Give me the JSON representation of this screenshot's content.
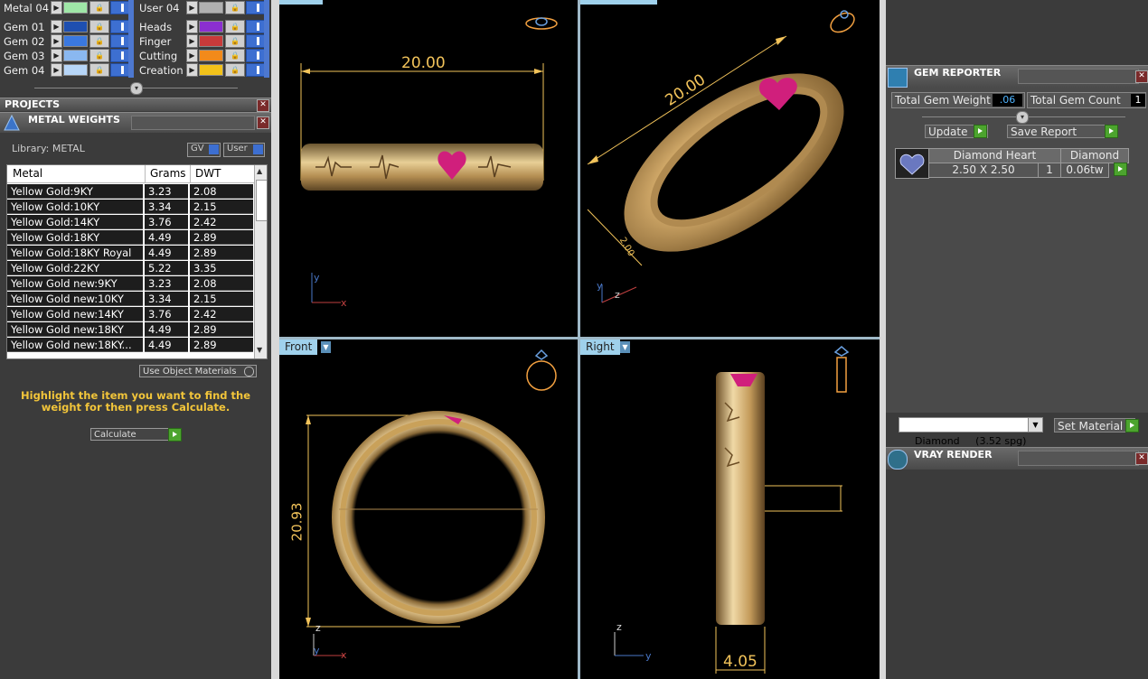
{
  "layers": {
    "left_column": [
      {
        "name": "Metal 04",
        "color": "#9fe6a7"
      },
      {
        "name": "Gem 01",
        "color": "#1e4fb0"
      },
      {
        "name": "Gem 02",
        "color": "#3a78e0"
      },
      {
        "name": "Gem 03",
        "color": "#8ab8f0"
      },
      {
        "name": "Gem 04",
        "color": "#b7d6f8"
      }
    ],
    "right_column": [
      {
        "name": "User 04",
        "color": "#b0b0b0"
      },
      {
        "name": "Heads",
        "color": "#8b2fd0"
      },
      {
        "name": "Finger",
        "color": "#c83a3a"
      },
      {
        "name": "Cutting",
        "color": "#f28a1a"
      },
      {
        "name": "Creation",
        "color": "#f2c21a"
      }
    ]
  },
  "projects": {
    "title": "PROJECTS"
  },
  "metal_weights": {
    "title": "METAL WEIGHTS",
    "library_label": "Library: METAL",
    "gv_label": "GV",
    "user_label": "User",
    "columns": [
      "Metal",
      "Grams",
      "DWT"
    ],
    "rows": [
      [
        "Yellow Gold:9KY",
        "3.23",
        "2.08"
      ],
      [
        "Yellow Gold:10KY",
        "3.34",
        "2.15"
      ],
      [
        "Yellow Gold:14KY",
        "3.76",
        "2.42"
      ],
      [
        "Yellow Gold:18KY",
        "4.49",
        "2.89"
      ],
      [
        "Yellow Gold:18KY Royal",
        "4.49",
        "2.89"
      ],
      [
        "Yellow Gold:22KY",
        "5.22",
        "3.35"
      ],
      [
        "Yellow Gold new:9KY",
        "3.23",
        "2.08"
      ],
      [
        "Yellow Gold new:10KY",
        "3.34",
        "2.15"
      ],
      [
        "Yellow Gold new:14KY",
        "3.76",
        "2.42"
      ],
      [
        "Yellow Gold new:18KY",
        "4.49",
        "2.89"
      ],
      [
        "Yellow Gold new:18KY...",
        "4.49",
        "2.89"
      ]
    ],
    "use_object_materials": "Use Object Materials",
    "instruction": "Highlight the item you want to find the weight for then press Calculate.",
    "calculate_label": "Calculate"
  },
  "viewports": {
    "top": {
      "dimension": "20.00"
    },
    "perspective": {
      "dimension_long": "20.00",
      "dimension_short": "2.00"
    },
    "front": {
      "label": "Front",
      "dimension": "20.93"
    },
    "right": {
      "label": "Right",
      "dimension": "4.05"
    }
  },
  "gem_reporter": {
    "title": "GEM REPORTER",
    "total_weight_label": "Total Gem Weight",
    "total_weight_value": ".06",
    "total_count_label": "Total Gem Count",
    "total_count_value": "1",
    "update_label": "Update",
    "save_report_label": "Save Report",
    "table": {
      "header": [
        "Diamond Heart",
        "Diamond"
      ],
      "size": "2.50 X 2.50",
      "qty": "1",
      "weight": "0.06tw"
    },
    "material_select": "Diamond     (3.52 spg)",
    "set_material_label": "Set Material"
  },
  "vray": {
    "title": "VRAY RENDER"
  },
  "colors": {
    "gold": "#c9a15a",
    "dim_line": "#f2c35a",
    "gem_pink": "#d01f7c",
    "viewport_label": "#9fd1ec"
  }
}
